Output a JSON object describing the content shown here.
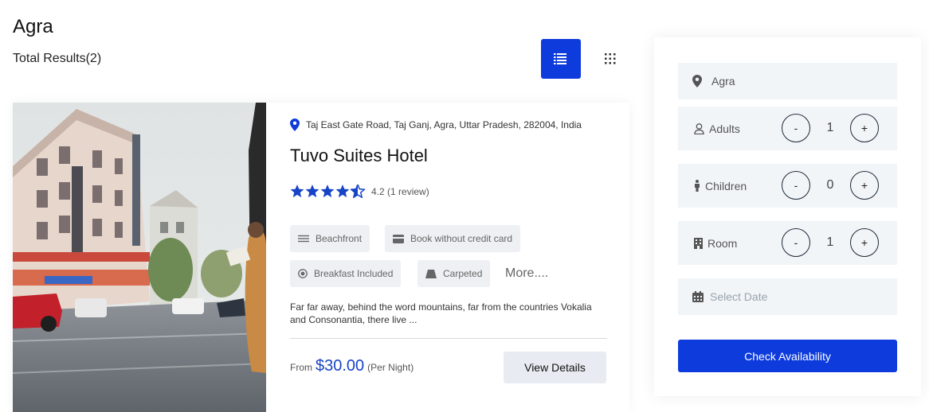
{
  "page": {
    "title": "Agra",
    "total_results": "Total Results(2)"
  },
  "view_toggle": {
    "list_icon": "list-icon",
    "grid_icon": "grid-icon",
    "active": "list"
  },
  "hotel": {
    "address": "Taj East Gate Road, Taj Ganj, Agra, Uttar Pradesh, 282004, India",
    "name": "Tuvo Suites Hotel",
    "rating": 4.2,
    "rating_text": "4.2 (1 review)",
    "amenities": [
      {
        "label": "Beachfront",
        "icon": "waves-icon"
      },
      {
        "label": "Book without credit card",
        "icon": "credit-card-icon"
      },
      {
        "label": "Breakfast Included",
        "icon": "breakfast-icon"
      },
      {
        "label": "Carpeted",
        "icon": "carpet-icon"
      }
    ],
    "more_label": "More....",
    "description": "Far far away, behind the word mountains, far from the countries Vokalia and Consonantia, there live ...",
    "price_from": "From",
    "price": "$30.00",
    "price_per": "(Per Night)",
    "view_details_label": "View Details"
  },
  "search_panel": {
    "location": "Agra",
    "adults_label": "Adults",
    "adults_count": "1",
    "children_label": "Children",
    "children_count": "0",
    "room_label": "Room",
    "room_count": "1",
    "minus_label": "-",
    "plus_label": "+",
    "date_placeholder": "Select Date",
    "check_label": "Check Availability"
  },
  "colors": {
    "accent": "#0d3bdc",
    "price": "#1744c7",
    "field_bg": "#f1f5f8",
    "chip_bg": "#eef0f3"
  }
}
